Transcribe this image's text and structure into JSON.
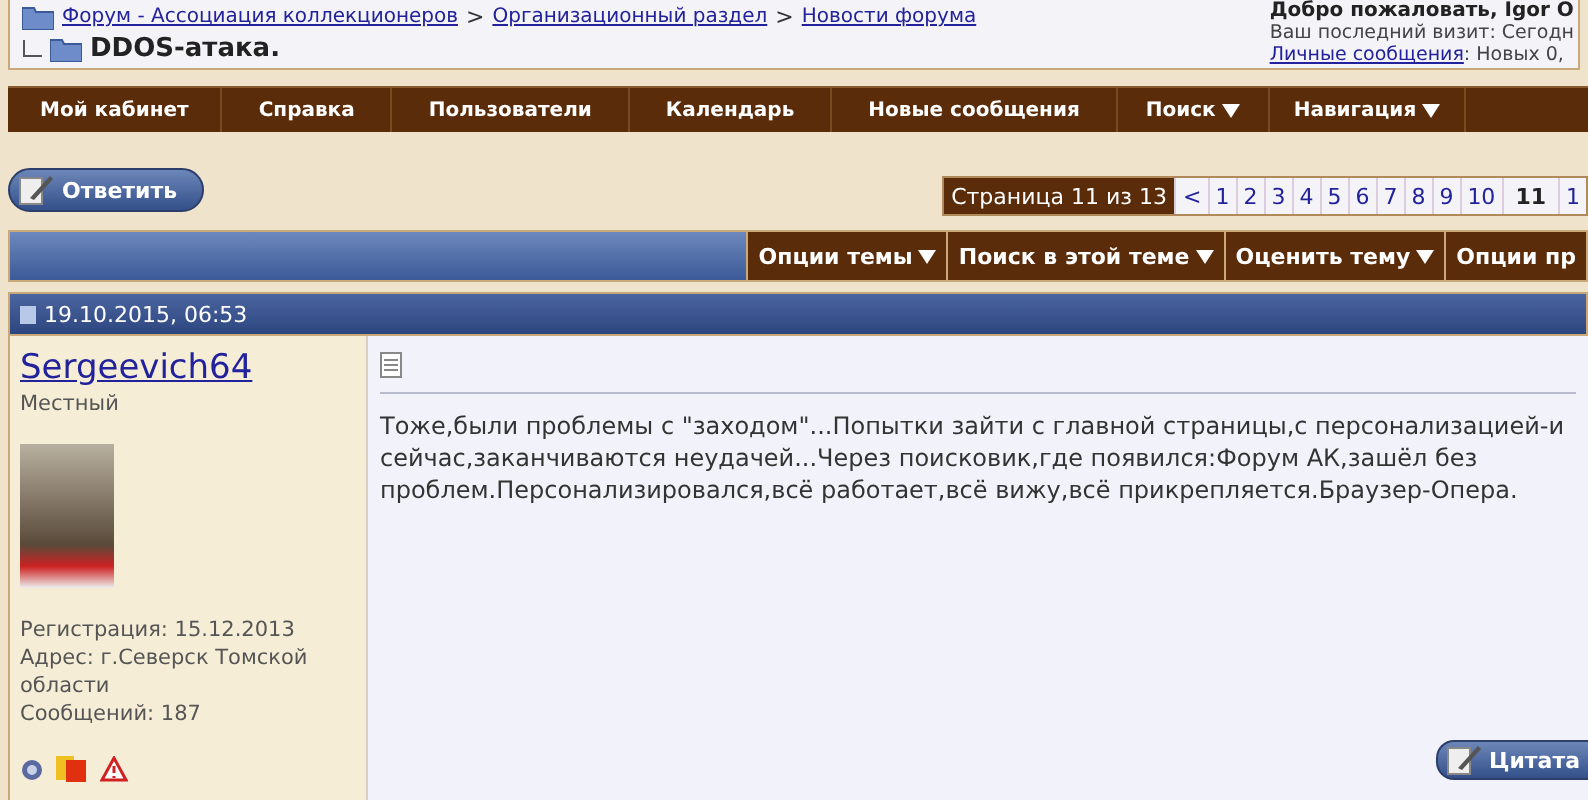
{
  "breadcrumb": {
    "links": [
      "Форум - Ассоциация коллекционеров",
      "Организационный раздел",
      "Новости форума"
    ],
    "separator": ">",
    "title": "DDOS-атака."
  },
  "welcome": {
    "greeting": "Добро пожаловать, Igor O",
    "last_visit": "Ваш последний визит: Сегодн",
    "messages_link": "Личные сообщения",
    "messages_text": ": Новых 0,"
  },
  "navbar": [
    {
      "label": "Мой кабинет",
      "dropdown": false
    },
    {
      "label": "Справка",
      "dropdown": false
    },
    {
      "label": "Пользователи",
      "dropdown": false
    },
    {
      "label": "Календарь",
      "dropdown": false
    },
    {
      "label": "Новые сообщения",
      "dropdown": false
    },
    {
      "label": "Поиск",
      "dropdown": true
    },
    {
      "label": "Навигация",
      "dropdown": true
    }
  ],
  "reply_button": "Ответить",
  "pagination": {
    "label": "Страница 11 из 13",
    "pages": [
      {
        "label": "<",
        "selected": false
      },
      {
        "label": "1",
        "selected": false
      },
      {
        "label": "2",
        "selected": false
      },
      {
        "label": "3",
        "selected": false
      },
      {
        "label": "4",
        "selected": false
      },
      {
        "label": "5",
        "selected": false
      },
      {
        "label": "6",
        "selected": false
      },
      {
        "label": "7",
        "selected": false
      },
      {
        "label": "8",
        "selected": false
      },
      {
        "label": "9",
        "selected": false
      },
      {
        "label": "10",
        "selected": false
      },
      {
        "label": "11",
        "selected": true
      },
      {
        "label": "1",
        "selected": false
      }
    ]
  },
  "thread_tools": [
    {
      "label": "Опции темы",
      "dropdown": true
    },
    {
      "label": "Поиск в этой теме",
      "dropdown": true
    },
    {
      "label": "Оценить тему",
      "dropdown": true
    },
    {
      "label": "Опции пр",
      "dropdown": false
    }
  ],
  "post": {
    "date": "19.10.2015, 06:53",
    "author": "Sergeevich64",
    "rank": "Местный",
    "info": [
      "Регистрация: 15.12.2013",
      "Адрес: г.Северск Томской области",
      "Сообщений: 187"
    ],
    "text": "Тоже,были проблемы с \"заходом\"...Попытки зайти с главной страницы,с персонализацией-и сейчас,заканчиваются неудачей...Через поисковик,где появился:Форум АК,зашёл без проблем.Персонализировался,всё работает,всё вижу,всё прикрепляется.Браузер-Опера.",
    "quote_button": "Цитата"
  }
}
